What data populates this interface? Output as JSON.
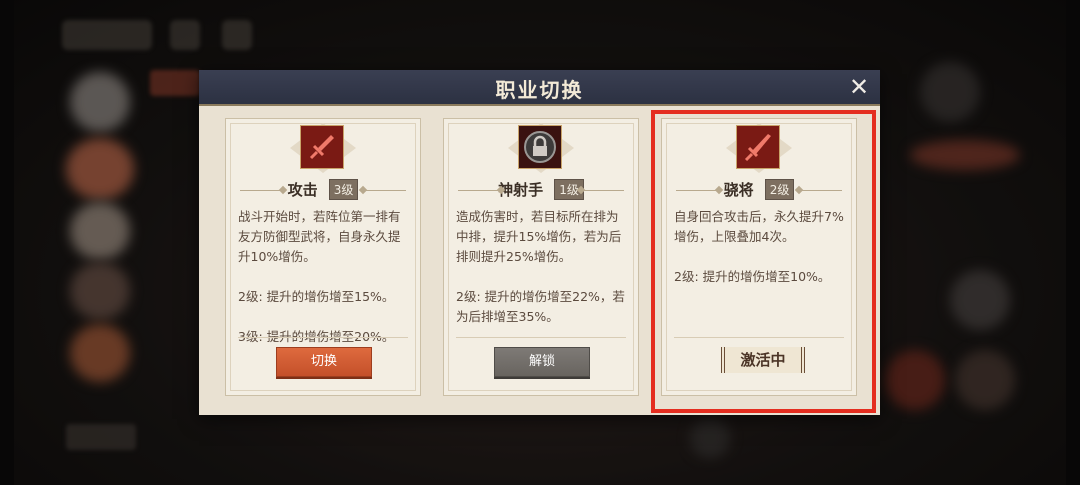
{
  "dialog": {
    "title": "职业切换",
    "close_symbol": "✕"
  },
  "cards": [
    {
      "icon": "sword-icon",
      "name": "攻击",
      "level": "3级",
      "desc": [
        "战斗开始时，若阵位第一排有友方防御型武将，自身永久提升10%增伤。",
        "2级: 提升的增伤增至15%。",
        "3级: 提升的增伤增至20%。"
      ],
      "action": "切换"
    },
    {
      "icon": "lock-icon",
      "name": "神射手",
      "level": "1级",
      "desc": [
        "造成伤害时，若目标所在排为中排，提升15%增伤，若为后排则提升25%增伤。",
        "2级: 提升的增伤增至22%，若为后排增至35%。"
      ],
      "action": "解锁"
    },
    {
      "icon": "blade-icon",
      "name": "骁将",
      "level": "2级",
      "desc": [
        "自身回合攻击后，永久提升7%增伤，上限叠加4次。",
        "2级: 提升的增伤增至10%。"
      ],
      "status": "激活中"
    }
  ],
  "colors": {
    "switch_button": "#d45a32",
    "unlock_button": "#737069",
    "highlight_border": "#e42d1f",
    "titlebar": "#333849"
  }
}
